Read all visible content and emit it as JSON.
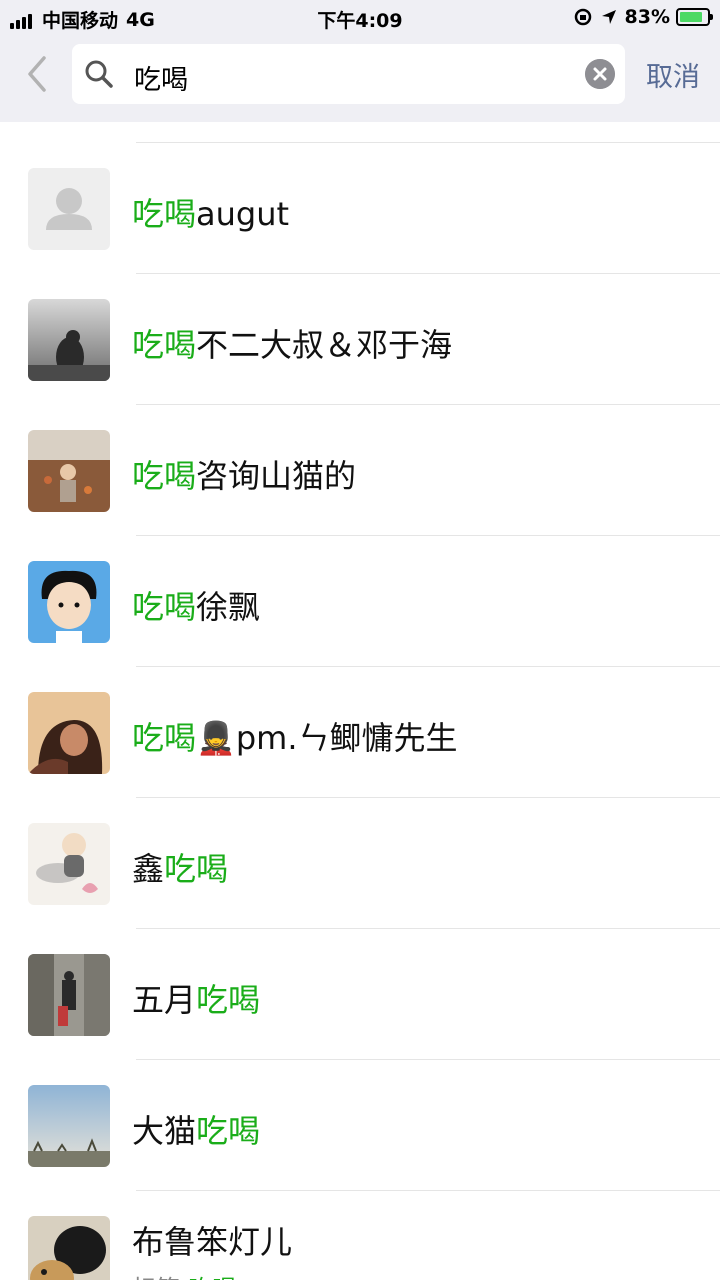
{
  "status_bar": {
    "carrier": "中国移动",
    "network": "4G",
    "time": "下午4:09",
    "battery": "83%",
    "battery_level": 0.83
  },
  "search": {
    "query": "吃喝",
    "cancel_label": "取消"
  },
  "results": [
    {
      "pre": "",
      "hl": "吃喝",
      "post": "augut",
      "avatar": "default-avatar"
    },
    {
      "pre": "",
      "hl": "吃喝",
      "post": "不二大叔＆邓于海",
      "avatar": "photo-grey"
    },
    {
      "pre": "",
      "hl": "吃喝",
      "post": "咨询山猫的",
      "avatar": "photo-field"
    },
    {
      "pre": "",
      "hl": "吃喝",
      "post": "徐飘",
      "avatar": "cartoon-boy"
    },
    {
      "pre": "",
      "hl": "吃喝",
      "post": "💂pm.ㄣ鲫慵先生",
      "avatar": "photo-woman"
    },
    {
      "pre": "鑫",
      "hl": "吃喝",
      "post": "",
      "avatar": "ink-monk"
    },
    {
      "pre": "五月",
      "hl": "吃喝",
      "post": "",
      "avatar": "photo-alley"
    },
    {
      "pre": "大猫",
      "hl": "吃喝",
      "post": "",
      "avatar": "photo-sky"
    },
    {
      "pre": "布鲁笨灯儿",
      "hl": "",
      "post": "",
      "avatar": "photo-dog",
      "sub_pre": "标签:",
      "sub_hl": "吃喝"
    }
  ]
}
